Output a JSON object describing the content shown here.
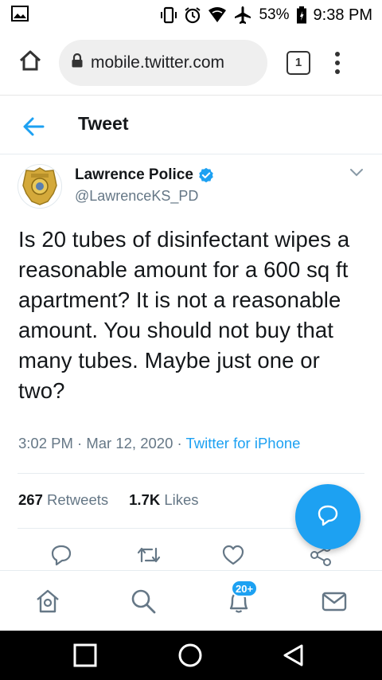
{
  "status_bar": {
    "battery_pct": "53%",
    "time": "9:38 PM"
  },
  "browser": {
    "url": "mobile.twitter.com",
    "tab_count": "1"
  },
  "header": {
    "title": "Tweet"
  },
  "tweet": {
    "author_name": "Lawrence Police",
    "author_handle": "@LawrenceKS_PD",
    "text": "Is 20 tubes of disinfectant wipes a reasonable amount for a 600 sq ft apartment? It is not a reasonable amount. You should not buy that many tubes. Maybe just one or two?",
    "time": "3:02 PM",
    "date": "Mar 12, 2020",
    "source": "Twitter for iPhone",
    "retweet_count": "267",
    "retweet_label": "Retweets",
    "like_count": "1.7K",
    "like_label": "Likes"
  },
  "bottom_nav": {
    "notification_badge": "20+"
  },
  "colors": {
    "accent": "#1da1f2",
    "text": "#14171a",
    "muted": "#657786"
  }
}
